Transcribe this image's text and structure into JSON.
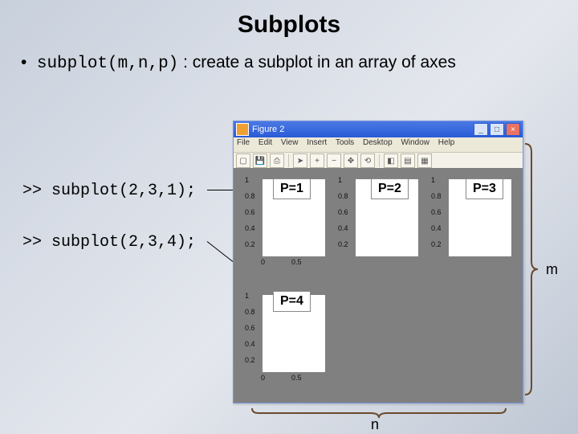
{
  "title": "Subplots",
  "bullet": {
    "code": "subplot(m,n,p)",
    "text": ": create a subplot in an array of axes"
  },
  "code1": ">> subplot(2,3,1);",
  "code2": ">> subplot(2,3,4);",
  "figwin": {
    "title": "Figure 2",
    "menus": [
      "File",
      "Edit",
      "View",
      "Insert",
      "Tools",
      "Desktop",
      "Window",
      "Help"
    ],
    "toolbar_icons": [
      "file-new",
      "save",
      "print",
      "|",
      "pointer",
      "zoom-in",
      "zoom-out",
      "pan",
      "rotate",
      "|",
      "data-cursor",
      "colorbar",
      "legend",
      "|",
      "grid"
    ]
  },
  "axes_ticks": {
    "y": [
      "1",
      "0.8",
      "0.6",
      "0.4",
      "0.2"
    ],
    "x": [
      "0",
      "0.5"
    ]
  },
  "p_labels": {
    "p1": "P=1",
    "p2": "P=2",
    "p3": "P=3",
    "p4": "P=4"
  },
  "brace_n": "n",
  "brace_m": "m"
}
